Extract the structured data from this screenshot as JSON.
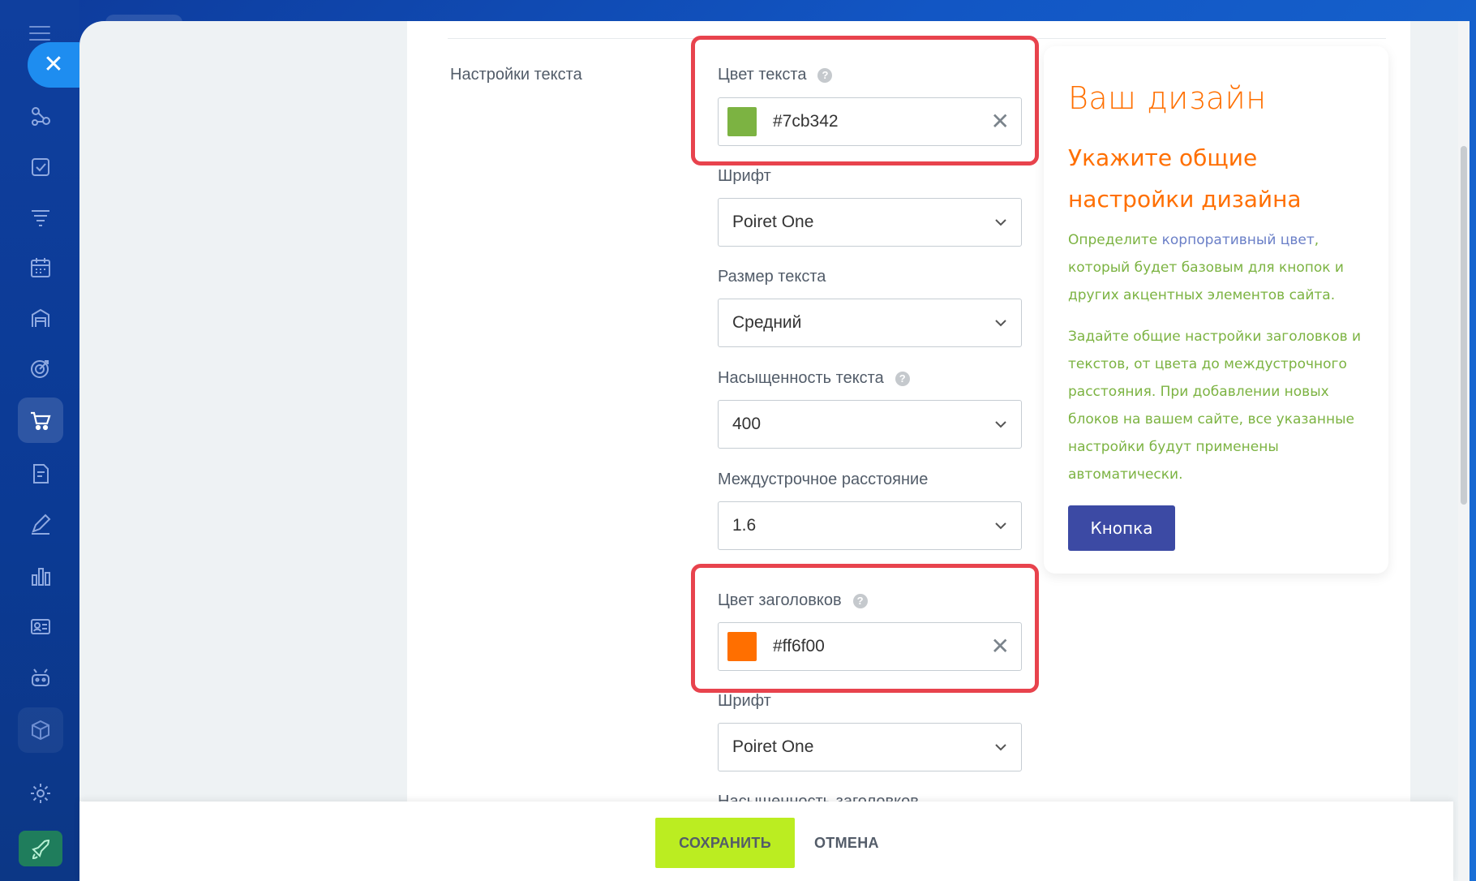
{
  "section": {
    "text_settings_label": "Настройки текста"
  },
  "text_color": {
    "label": "Цвет текста",
    "value": "#7cb342",
    "swatch": "#7cb342"
  },
  "text_font": {
    "label": "Шрифт",
    "value": "Poiret One"
  },
  "text_size": {
    "label": "Размер текста",
    "value": "Средний"
  },
  "text_weight": {
    "label": "Насыщенность текста",
    "value": "400"
  },
  "line_height": {
    "label": "Междустрочное расстояние",
    "value": "1.6"
  },
  "heading_color": {
    "label": "Цвет заголовков",
    "value": "#ff6f00",
    "swatch": "#ff6f00"
  },
  "heading_font": {
    "label": "Шрифт",
    "value": "Poiret One"
  },
  "heading_weight": {
    "label": "Насыщенность заголовков"
  },
  "preview": {
    "title": "Ваш дизайн",
    "subtitle": "Укажите общие настройки дизайна",
    "p1_before": "Определите ",
    "p1_accent": "корпоративный цвет",
    "p1_after": ", который будет базовым для кнопок и других акцентных элементов сайта.",
    "p2": "Задайте общие настройки заголовков и текстов, от цвета до междустрочного расстояния. При добавлении новых блоков на вашем сайте, все указанные настройки будут применены автоматически.",
    "button": "Кнопка"
  },
  "footer": {
    "save": "СОХРАНИТЬ",
    "cancel": "ОТМЕНА"
  },
  "colors": {
    "highlight": "#e8434d",
    "save_button": "#bbed21",
    "preview_button": "#3c4aa4"
  }
}
